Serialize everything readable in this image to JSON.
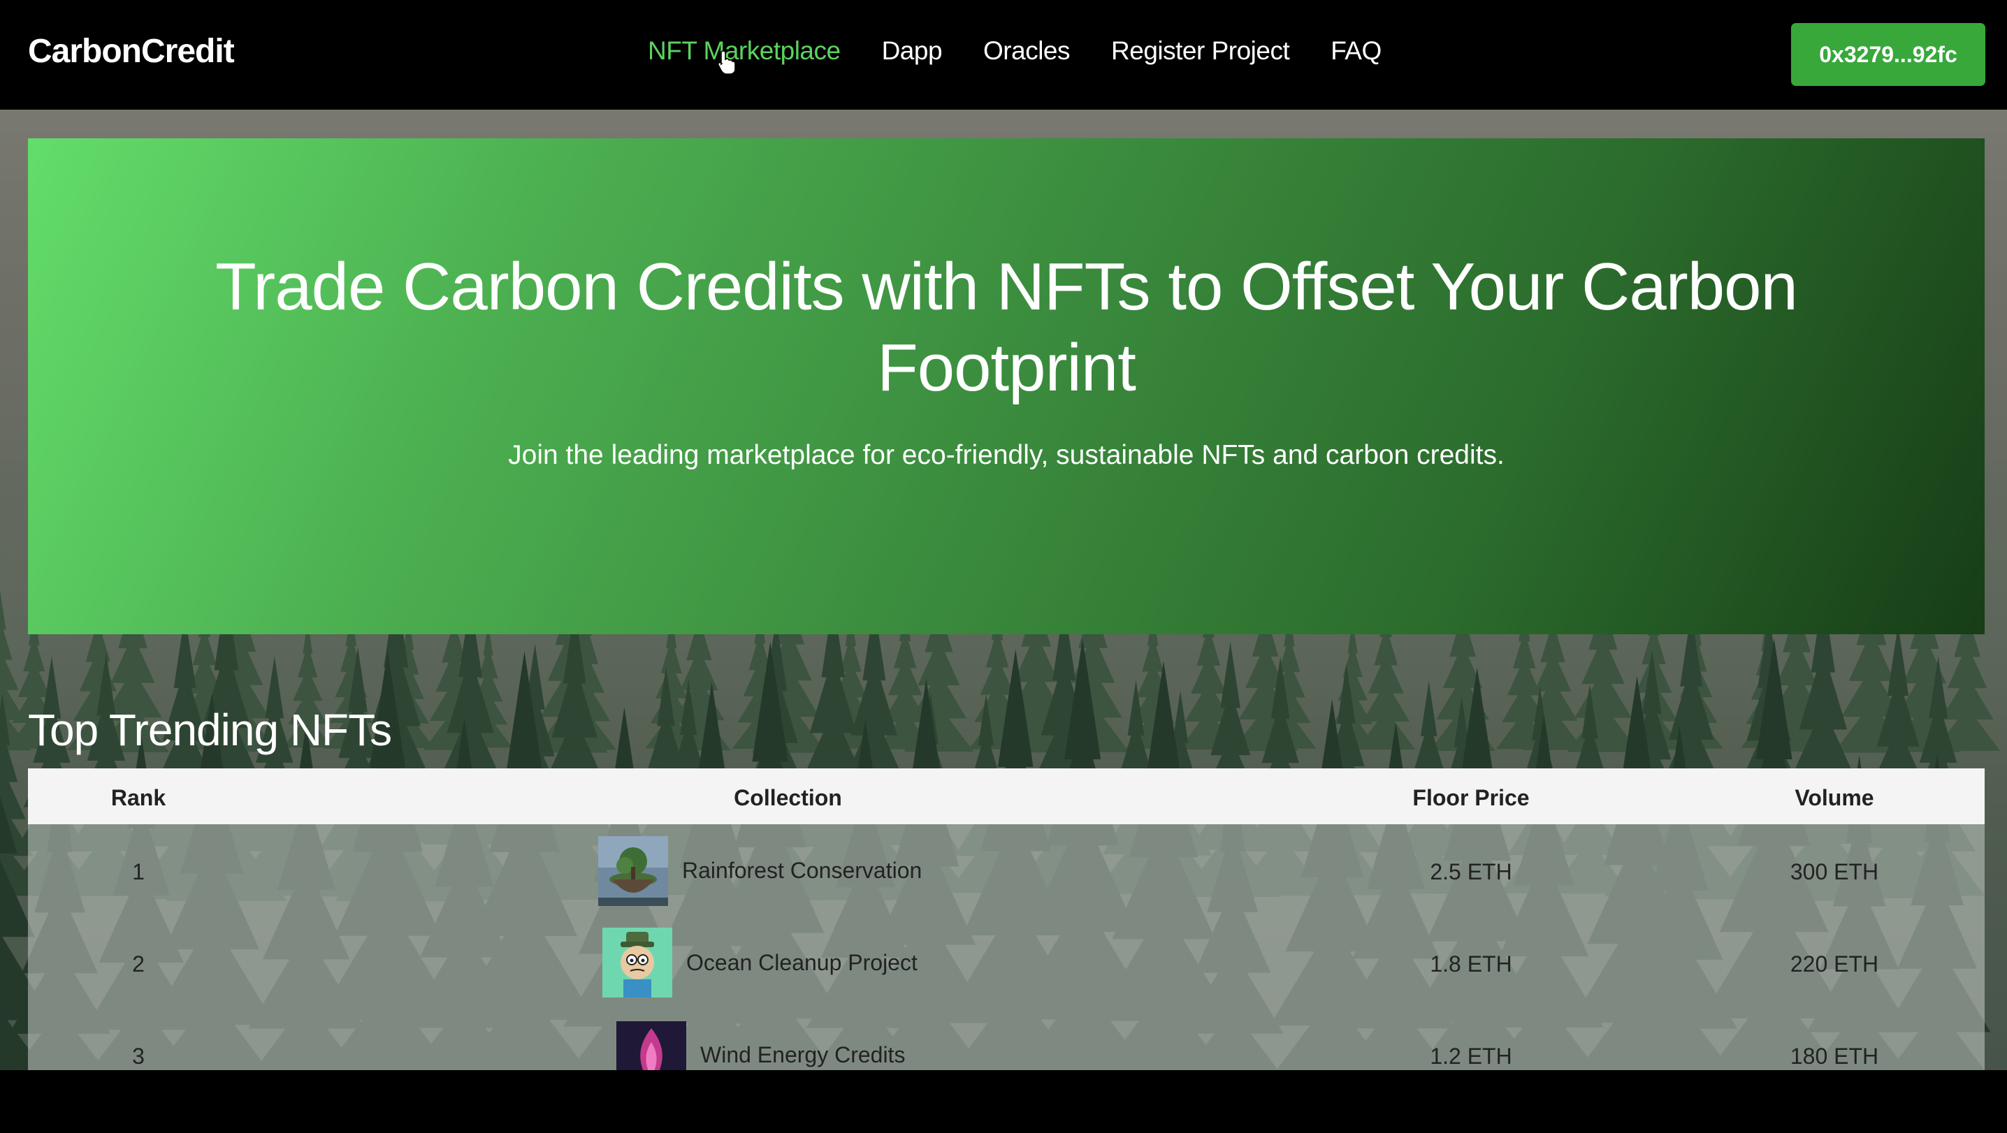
{
  "nav": {
    "logo": "CarbonCredit",
    "links": [
      {
        "label": "NFT Marketplace",
        "active": true
      },
      {
        "label": "Dapp",
        "active": false
      },
      {
        "label": "Oracles",
        "active": false
      },
      {
        "label": "Register Project",
        "active": false
      },
      {
        "label": "FAQ",
        "active": false
      }
    ],
    "wallet": "0x3279...92fc"
  },
  "hero": {
    "title": "Trade Carbon Credits with NFTs to Offset Your Carbon Footprint",
    "subtitle": "Join the leading marketplace for eco-friendly, sustainable NFTs and carbon credits."
  },
  "trending": {
    "title": "Top Trending NFTs",
    "columns": [
      "Rank",
      "Collection",
      "Floor Price",
      "Volume"
    ],
    "rows": [
      {
        "rank": "1",
        "collection": "Rainforest Conservation",
        "floor": "2.5 ETH",
        "volume": "300 ETH",
        "thumb": "floating-island-thumbnail"
      },
      {
        "rank": "2",
        "collection": "Ocean Cleanup Project",
        "floor": "1.8 ETH",
        "volume": "220 ETH",
        "thumb": "cartoon-character-thumbnail"
      },
      {
        "rank": "3",
        "collection": "Wind Energy Credits",
        "floor": "1.2 ETH",
        "volume": "180 ETH",
        "thumb": "pink-flame-thumbnail"
      }
    ]
  },
  "colors": {
    "accent": "#38a83b",
    "active_link": "#5cd25f",
    "hero_start": "#63dd6b",
    "hero_end": "#173d17"
  }
}
